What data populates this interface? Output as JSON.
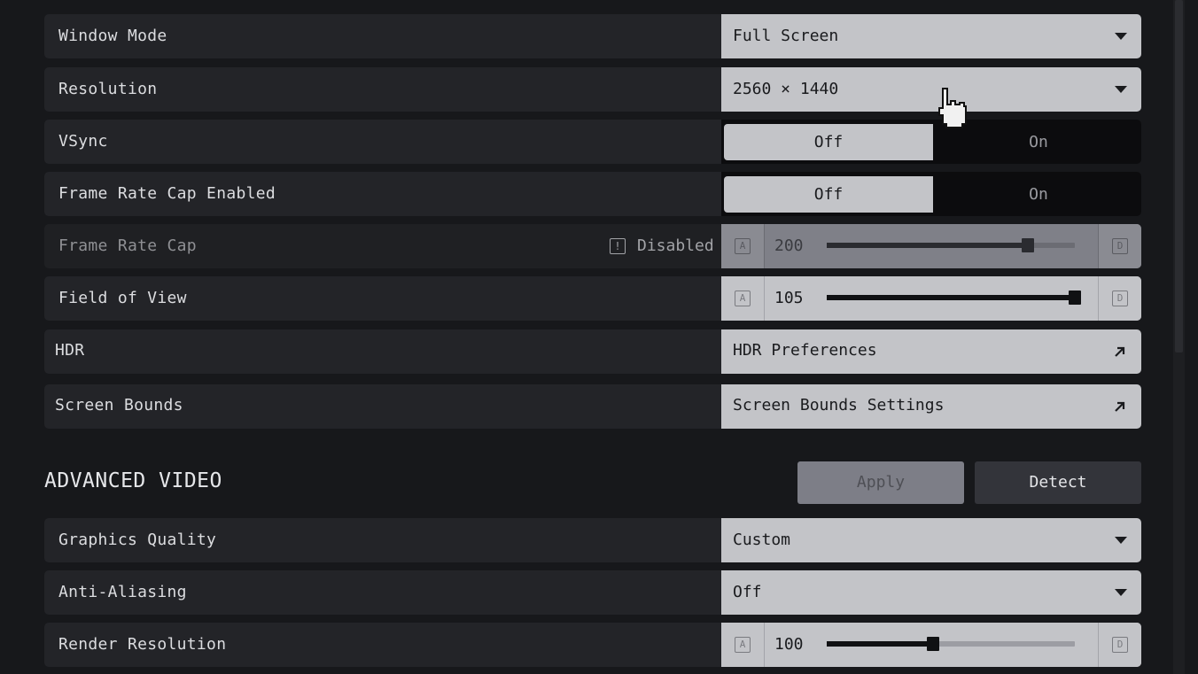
{
  "video": {
    "window_mode": {
      "label": "Window Mode",
      "value": "Full Screen"
    },
    "resolution": {
      "label": "Resolution",
      "value": "2560 × 1440"
    },
    "vsync": {
      "label": "VSync",
      "off_label": "Off",
      "on_label": "On",
      "selected": "Off"
    },
    "frame_rate_cap_enabled": {
      "label": "Frame Rate Cap Enabled",
      "off_label": "Off",
      "on_label": "On",
      "selected": "Off"
    },
    "frame_rate_cap": {
      "label": "Frame Rate Cap",
      "status": "Disabled",
      "value": "200",
      "fraction": 0.81,
      "key_left": "A",
      "key_right": "D"
    },
    "field_of_view": {
      "label": "Field of View",
      "value": "105",
      "fraction": 1.0,
      "key_left": "A",
      "key_right": "D"
    },
    "hdr": {
      "label": "HDR",
      "button": "HDR Preferences"
    },
    "screen_bounds": {
      "label": "Screen Bounds",
      "button": "Screen Bounds Settings"
    }
  },
  "advanced": {
    "title": "ADVANCED VIDEO",
    "apply_label": "Apply",
    "detect_label": "Detect",
    "graphics_quality": {
      "label": "Graphics Quality",
      "value": "Custom"
    },
    "anti_aliasing": {
      "label": "Anti-Aliasing",
      "value": "Off"
    },
    "render_resolution": {
      "label": "Render Resolution",
      "value": "100",
      "fraction": 0.43,
      "key_left": "A",
      "key_right": "D"
    }
  },
  "icons": {
    "warning": "exclamation-box-icon",
    "dropdown": "chevron-down-icon",
    "external": "arrow-up-right-icon",
    "cursor": "hand-pointer-icon"
  },
  "colors": {
    "panel": "#232428",
    "control": "#c3c4c8",
    "background": "#17181b"
  }
}
